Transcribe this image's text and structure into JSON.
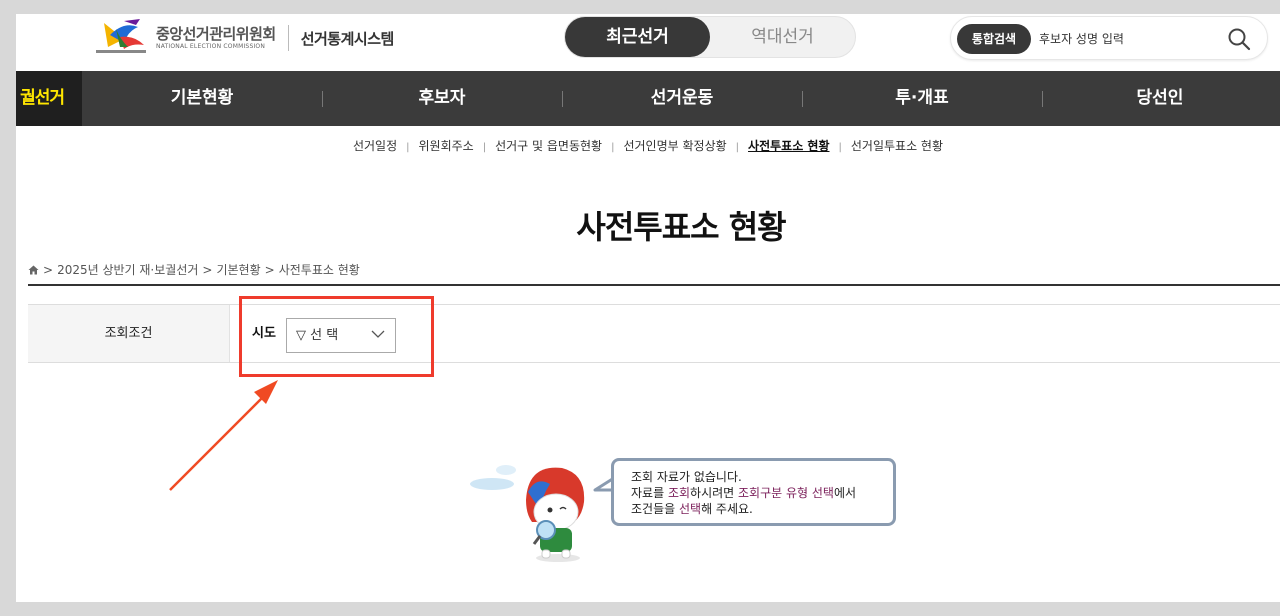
{
  "header": {
    "org_name": "중앙선거관리위원회",
    "org_name_en": "NATIONAL ELECTION COMMISSION",
    "system_name": "선거통계시스템",
    "toggle": {
      "recent": "최근선거",
      "history": "역대선거"
    },
    "search": {
      "badge": "통합검색",
      "placeholder": "후보자 성명 입력"
    }
  },
  "gnb": {
    "side_label": "궐선거",
    "items": [
      "기본현황",
      "후보자",
      "선거운동",
      "투·개표",
      "당선인"
    ]
  },
  "lnb": {
    "items": [
      "선거일정",
      "위원회주소",
      "선거구 및 읍면동현황",
      "선거인명부 확정상황",
      "사전투표소 현황",
      "선거일투표소 현황"
    ],
    "active_index": 4
  },
  "page_title": "사전투표소 현황",
  "breadcrumb": {
    "items": [
      "2025년 상반기 재·보궐선거",
      "기본현황",
      "사전투표소 현황"
    ]
  },
  "filter": {
    "header": "조회조건",
    "sido_label": "시도",
    "sido_value": "▽ 선 택"
  },
  "empty_state": {
    "line1": "조회 자료가 없습니다.",
    "line2": {
      "p1": "자료를 ",
      "h1": "조회",
      "p2": "하시려면 ",
      "h2": "조회구분 유형 선택",
      "p3": "에서"
    },
    "line3": {
      "p1": "조건들을 ",
      "h1": "선택",
      "p2": "해 주세요."
    }
  },
  "colors": {
    "nav_bg": "#3b3b3b",
    "accent_yellow": "#ffe600",
    "highlight_red": "#ef3b2c",
    "emphasis_purple": "#7b1f5a"
  }
}
